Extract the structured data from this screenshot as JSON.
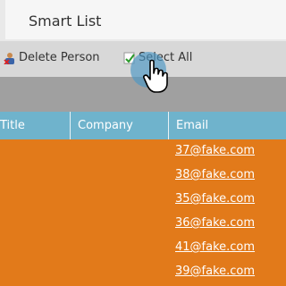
{
  "header": {
    "title": "Smart List"
  },
  "toolbar": {
    "delete_person_label": "Delete Person",
    "select_all_label": "Select All",
    "icons": {
      "delete_person": "person-x-icon",
      "select_all": "checkbox-check-icon"
    }
  },
  "table": {
    "columns": [
      "Title",
      "Company",
      "Email"
    ],
    "rows": [
      {
        "email": "37@fake.com"
      },
      {
        "email": "38@fake.com"
      },
      {
        "email": "35@fake.com"
      },
      {
        "email": "36@fake.com"
      },
      {
        "email": "41@fake.com"
      },
      {
        "email": "39@fake.com"
      }
    ]
  },
  "colors": {
    "header_bg": "#6fb3cc",
    "row_bg": "#e27a1a",
    "highlight": "#4a96c4"
  }
}
